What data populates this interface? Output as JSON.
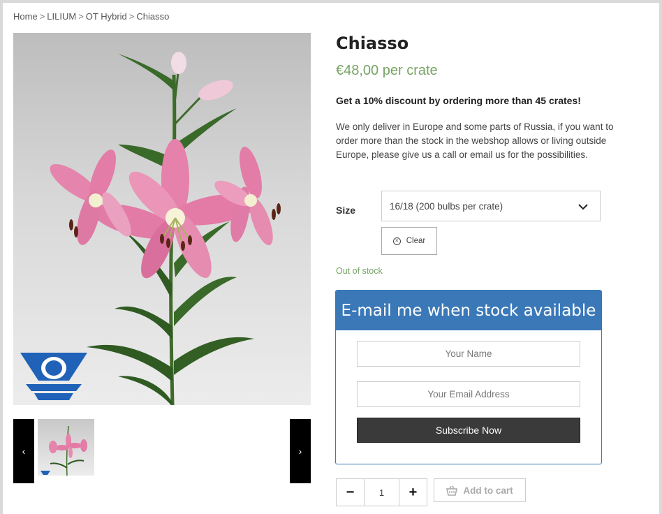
{
  "breadcrumb": {
    "home": "Home",
    "category": "LILIUM",
    "subcategory": "OT Hybrid",
    "current": "Chiasso",
    "separator": ">"
  },
  "product": {
    "title": "Chiasso",
    "price": "€48,00 per crate",
    "discount": "Get a 10% discount by ordering more than 45 crates!",
    "delivery": "We only deliver in Europe and some parts of Russia, if you want to order more than the stock in the webshop allows or living outside Europe, please give us a call or email us for the possibilities.",
    "stock_status": "Out of stock"
  },
  "variation": {
    "size_label": "Size",
    "size_value": "16/18 (200 bulbs per crate)",
    "clear_label": "Clear"
  },
  "notify": {
    "header": "E-mail me when stock available",
    "name_placeholder": "Your Name",
    "email_placeholder": "Your Email Address",
    "subscribe_label": "Subscribe Now"
  },
  "cart": {
    "minus": "−",
    "quantity": "1",
    "plus": "+",
    "add_label": "Add to cart"
  },
  "gallery": {
    "prev_icon": "‹",
    "next_icon": "›"
  },
  "colors": {
    "accent_blue": "#3a78b8",
    "price_green": "#77a464",
    "dark_button": "#3a3a3a"
  }
}
